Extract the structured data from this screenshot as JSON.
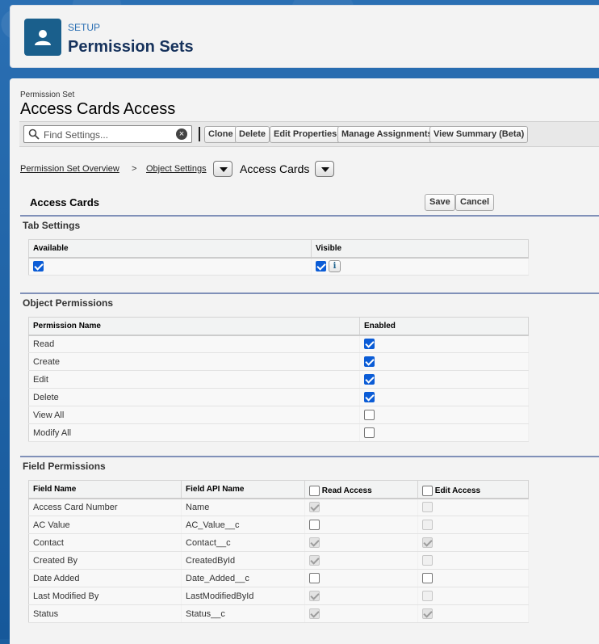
{
  "header": {
    "eyebrow": "SETUP",
    "title": "Permission Sets",
    "icon": "user-icon"
  },
  "permission_set": {
    "label": "Permission Set",
    "title": "Access Cards Access"
  },
  "toolbar": {
    "search_placeholder": "Find Settings...",
    "clone": "Clone",
    "delete": "Delete",
    "edit_properties": "Edit Properties",
    "manage_assignments": "Manage Assignments",
    "view_summary": "View Summary (Beta)"
  },
  "breadcrumb": {
    "overview": "Permission Set Overview",
    "separator": ">",
    "object_settings": "Object Settings",
    "current": "Access Cards"
  },
  "object_section": {
    "title": "Access Cards",
    "save": "Save",
    "cancel": "Cancel"
  },
  "tab_settings": {
    "heading": "Tab Settings",
    "columns": [
      "Available",
      "Visible"
    ],
    "available": true,
    "visible": true
  },
  "object_permissions": {
    "heading": "Object Permissions",
    "columns": [
      "Permission Name",
      "Enabled"
    ],
    "rows": [
      {
        "name": "Read",
        "enabled": true
      },
      {
        "name": "Create",
        "enabled": true
      },
      {
        "name": "Edit",
        "enabled": true
      },
      {
        "name": "Delete",
        "enabled": true
      },
      {
        "name": "View All",
        "enabled": false
      },
      {
        "name": "Modify All",
        "enabled": false
      }
    ]
  },
  "field_permissions": {
    "heading": "Field Permissions",
    "columns": [
      "Field Name",
      "Field API Name",
      "Read Access",
      "Edit Access"
    ],
    "rows": [
      {
        "field": "Access Card Number",
        "api": "Name",
        "read": true,
        "read_disabled": true,
        "edit": false,
        "edit_disabled": true
      },
      {
        "field": "AC Value",
        "api": "AC_Value__c",
        "read": false,
        "read_disabled": false,
        "edit": false,
        "edit_disabled": true
      },
      {
        "field": "Contact",
        "api": "Contact__c",
        "read": true,
        "read_disabled": true,
        "edit": true,
        "edit_disabled": true
      },
      {
        "field": "Created By",
        "api": "CreatedById",
        "read": true,
        "read_disabled": true,
        "edit": false,
        "edit_disabled": true
      },
      {
        "field": "Date Added",
        "api": "Date_Added__c",
        "read": false,
        "read_disabled": false,
        "edit": false,
        "edit_disabled": false
      },
      {
        "field": "Last Modified By",
        "api": "LastModifiedById",
        "read": true,
        "read_disabled": true,
        "edit": false,
        "edit_disabled": true
      },
      {
        "field": "Status",
        "api": "Status__c",
        "read": true,
        "read_disabled": true,
        "edit": true,
        "edit_disabled": true
      }
    ]
  },
  "colors": {
    "brand": "#1a5f8c",
    "checkbox_on": "#0b5cd6",
    "section_rule": "#8090b8"
  }
}
